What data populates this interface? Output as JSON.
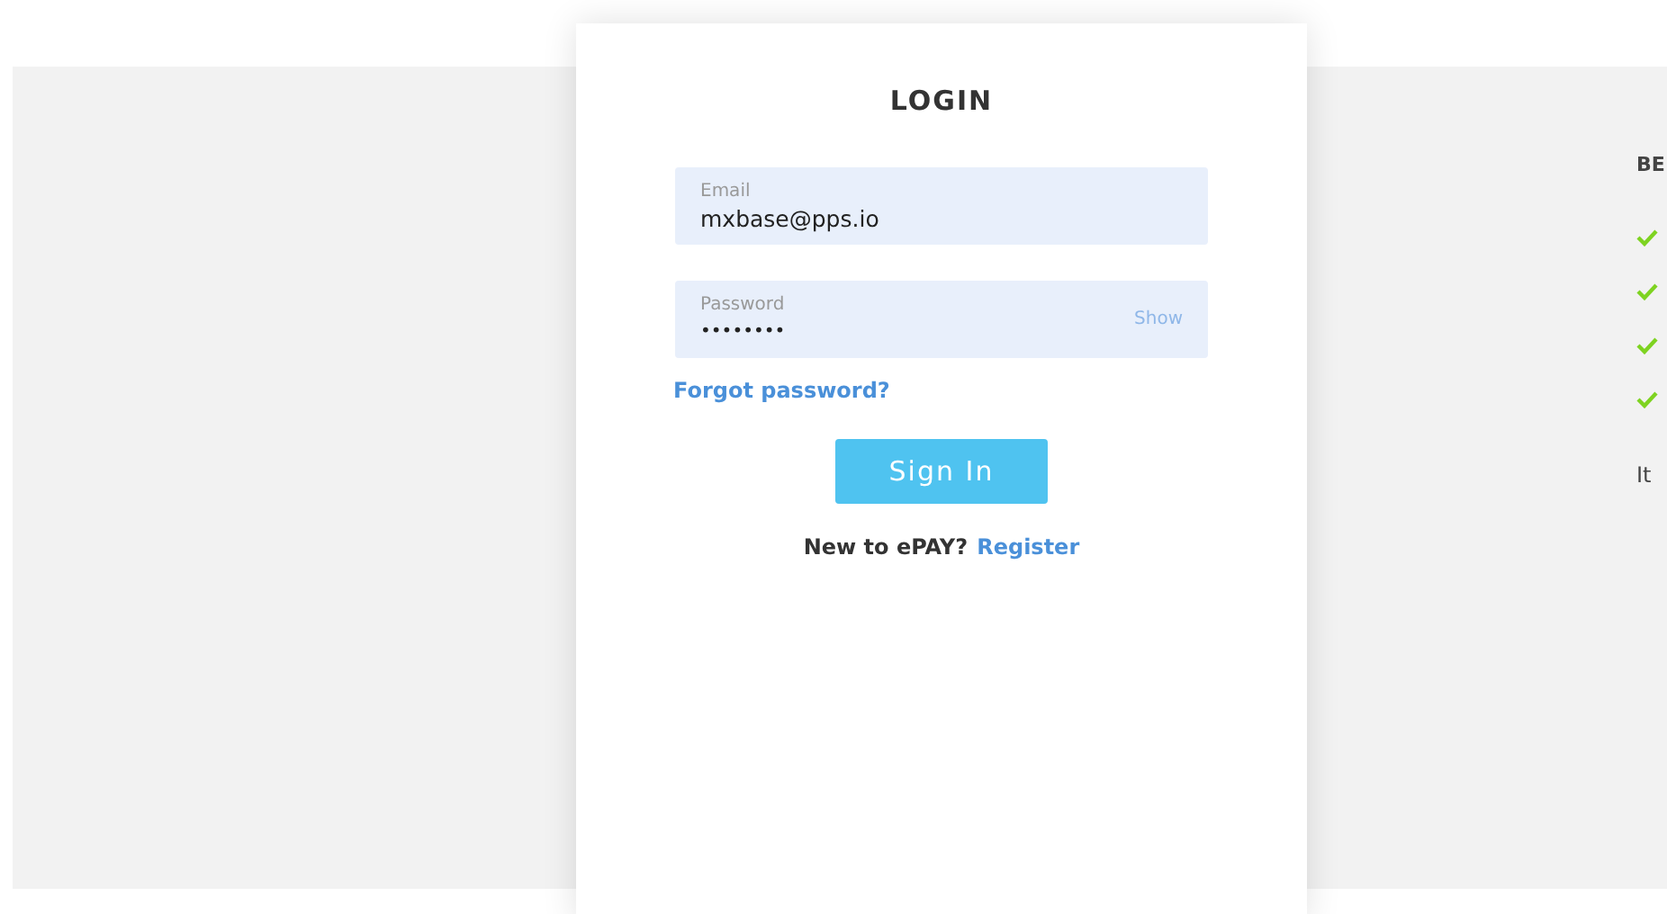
{
  "login": {
    "title": "LOGIN",
    "email": {
      "label": "Email",
      "value": "mxbase@pps.io"
    },
    "password": {
      "label": "Password",
      "value": "••••••••",
      "toggle": "Show"
    },
    "forgot_link": "Forgot password?",
    "submit": "Sign In",
    "register_prompt": "New to ePAY?",
    "register_link": "Register"
  },
  "side_panel": {
    "heading": "BE",
    "benefits": [
      {
        "checked": true
      },
      {
        "checked": true
      },
      {
        "checked": true
      },
      {
        "checked": true
      }
    ],
    "footer": "It"
  }
}
